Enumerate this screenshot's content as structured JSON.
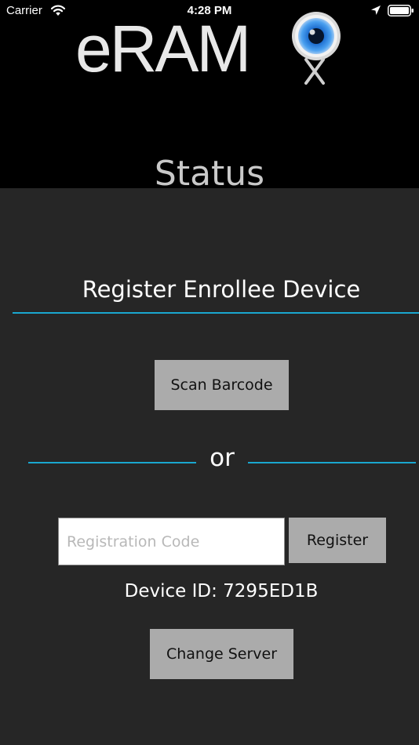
{
  "status_bar": {
    "carrier": "Carrier",
    "time": "4:28 PM",
    "icons": [
      "wifi-icon",
      "location-arrow-icon",
      "battery-icon"
    ]
  },
  "header": {
    "logo_text": "eRAM",
    "logo_icon": "eye-icon",
    "screen_title": "Status"
  },
  "main": {
    "section_title": "Register Enrollee Device",
    "scan_button_label": "Scan Barcode",
    "or_label": "or",
    "registration_input": {
      "placeholder": "Registration Code",
      "value": ""
    },
    "register_button_label": "Register",
    "device_id_text": "Device ID: 7295ED1B",
    "change_server_button_label": "Change Server"
  },
  "colors": {
    "accent": "#1aa7cf",
    "header_background": "#000000",
    "body_background": "#262626",
    "button_background": "#ababab"
  }
}
